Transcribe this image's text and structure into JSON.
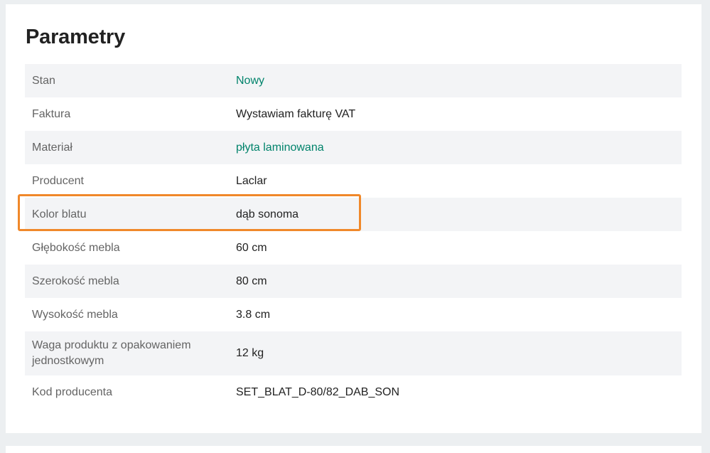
{
  "section": {
    "title": "Parametry"
  },
  "params": [
    {
      "label": "Stan",
      "value": "Nowy",
      "link": true
    },
    {
      "label": "Faktura",
      "value": "Wystawiam fakturę VAT",
      "link": false
    },
    {
      "label": "Materiał",
      "value": "płyta laminowana",
      "link": true
    },
    {
      "label": "Producent",
      "value": "Laclar",
      "link": false
    },
    {
      "label": "Kolor blatu",
      "value": "dąb sonoma",
      "link": false,
      "highlighted": true
    },
    {
      "label": "Głębokość mebla",
      "value": "60 cm",
      "link": false
    },
    {
      "label": "Szerokość mebla",
      "value": "80 cm",
      "link": false
    },
    {
      "label": "Wysokość mebla",
      "value": "3.8 cm",
      "link": false
    },
    {
      "label": "Waga produktu z opakowaniem jednostkowym",
      "value": "12 kg",
      "link": false
    },
    {
      "label": "Kod producenta",
      "value": "SET_BLAT_D-80/82_DAB_SON",
      "link": false
    }
  ],
  "colors": {
    "link": "#00836b",
    "highlight": "#f0882a",
    "row_stripe": "#f3f4f6"
  }
}
